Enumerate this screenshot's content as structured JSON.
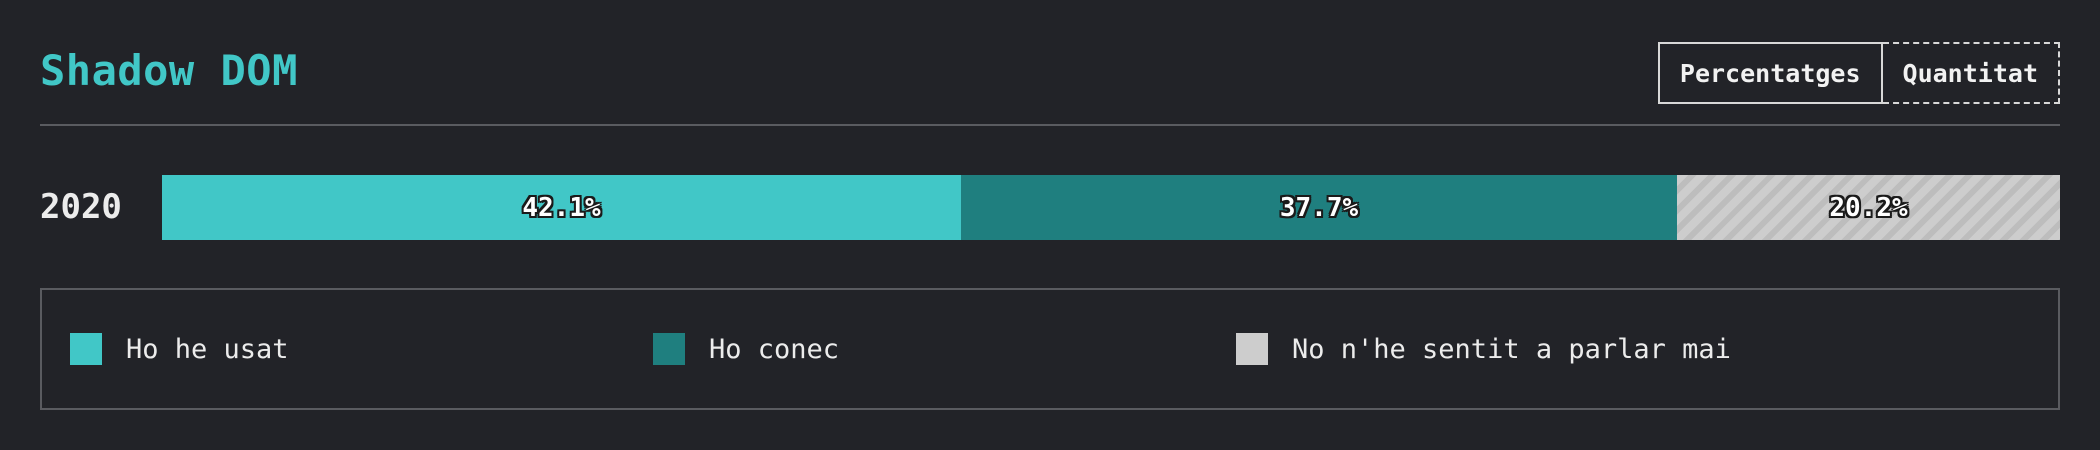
{
  "header": {
    "title": "Shadow DOM"
  },
  "toggle": {
    "percentages_label": "Percentatges",
    "quantity_label": "Quantitat",
    "active": "percentages"
  },
  "colors": {
    "background": "#222328",
    "title": "#41c7c7",
    "used": "#41c7c7",
    "known": "#1f7f7f",
    "never_heard": "#cdcdcd"
  },
  "chart_data": {
    "type": "bar",
    "orientation": "horizontal-stacked",
    "title": "Shadow DOM",
    "categories": [
      "2020"
    ],
    "series": [
      {
        "name": "Ho he usat",
        "values": [
          42.1
        ],
        "label": "42.1%",
        "color": "#41c7c7"
      },
      {
        "name": "Ho conec",
        "values": [
          37.7
        ],
        "label": "37.7%",
        "color": "#1f7f7f"
      },
      {
        "name": "No n'he sentit a parlar mai",
        "values": [
          20.2
        ],
        "label": "20.2%",
        "color": "#cdcdcd",
        "pattern": "hatched"
      }
    ],
    "xlim": [
      0,
      100
    ],
    "grid": false,
    "legend_position": "bottom"
  }
}
